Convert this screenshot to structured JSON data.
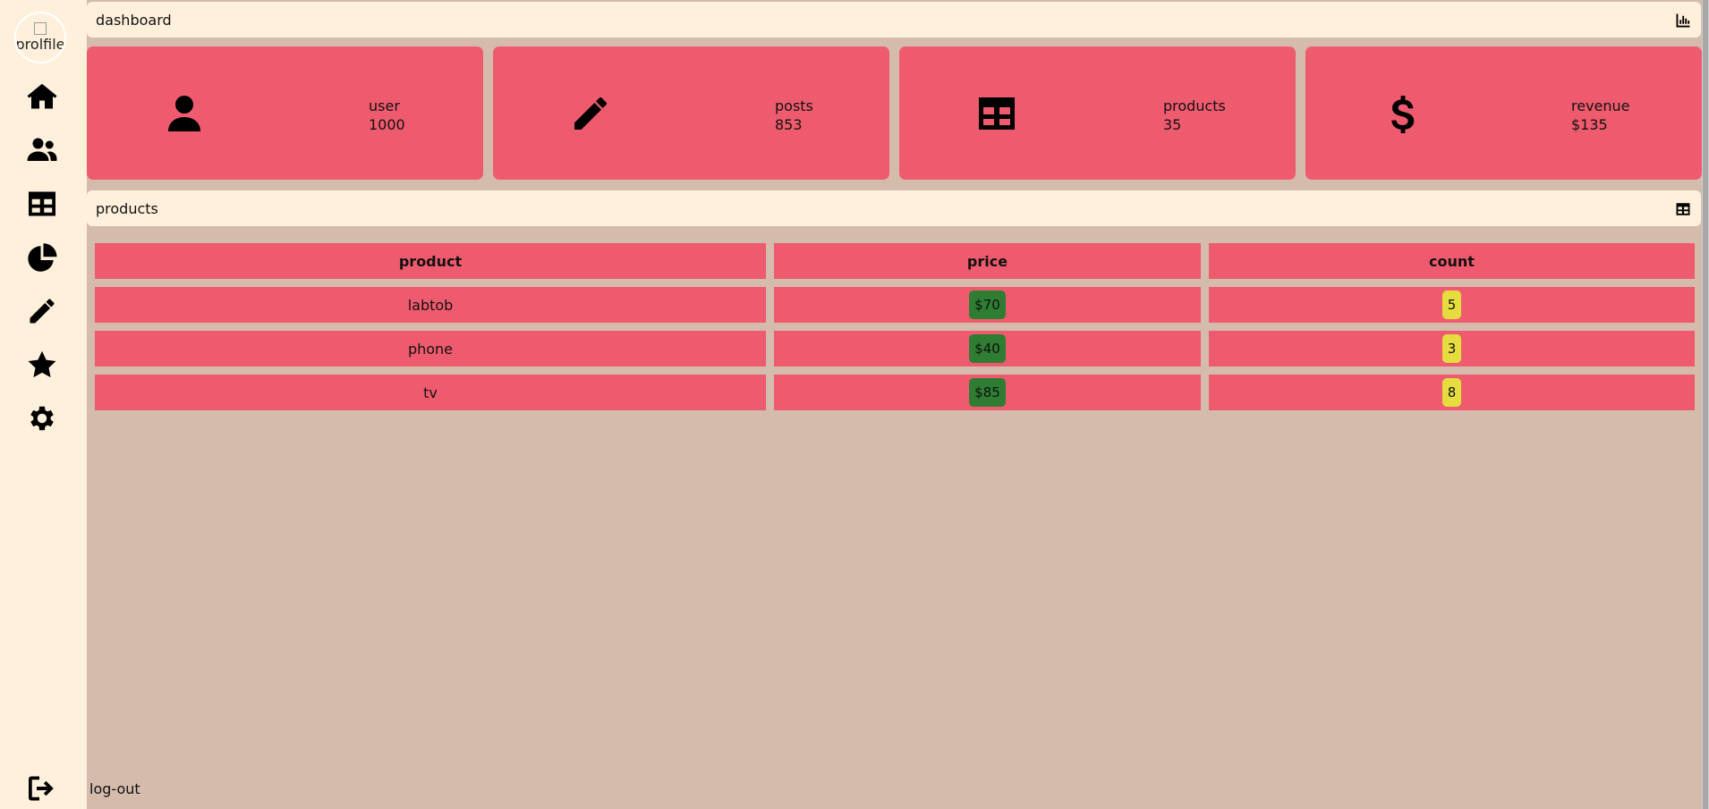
{
  "sidebar": {
    "avatar_alt": "prolfile",
    "items": [
      {
        "name": "home-icon"
      },
      {
        "name": "users-icon"
      },
      {
        "name": "table-icon"
      },
      {
        "name": "pie-chart-icon"
      },
      {
        "name": "pencil-icon"
      },
      {
        "name": "star-icon"
      },
      {
        "name": "gear-icon"
      }
    ],
    "logout_label": "log-out"
  },
  "dashboard_bar": {
    "title": "dashboard",
    "icon": "chart-icon"
  },
  "cards": [
    {
      "icon": "user-icon",
      "label": "user",
      "value": "1000"
    },
    {
      "icon": "pencil-icon",
      "label": "posts",
      "value": "853"
    },
    {
      "icon": "table-icon",
      "label": "products",
      "value": "35"
    },
    {
      "icon": "dollar-icon",
      "label": "revenue",
      "value": "$135"
    }
  ],
  "products_bar": {
    "title": "products",
    "icon": "table-icon"
  },
  "table": {
    "headers": [
      "product",
      "price",
      "count"
    ],
    "rows": [
      {
        "product": "labtob",
        "price": "$70",
        "count": "5"
      },
      {
        "product": "phone",
        "price": "$40",
        "count": "3"
      },
      {
        "product": "tv",
        "price": "$85",
        "count": "8"
      }
    ]
  },
  "colors": {
    "background": "#d4bbab",
    "sidebar": "#fff0dc",
    "card": "#ef5b6e",
    "price_badge": "#2e7d32",
    "count_badge": "#e5dd3f"
  }
}
